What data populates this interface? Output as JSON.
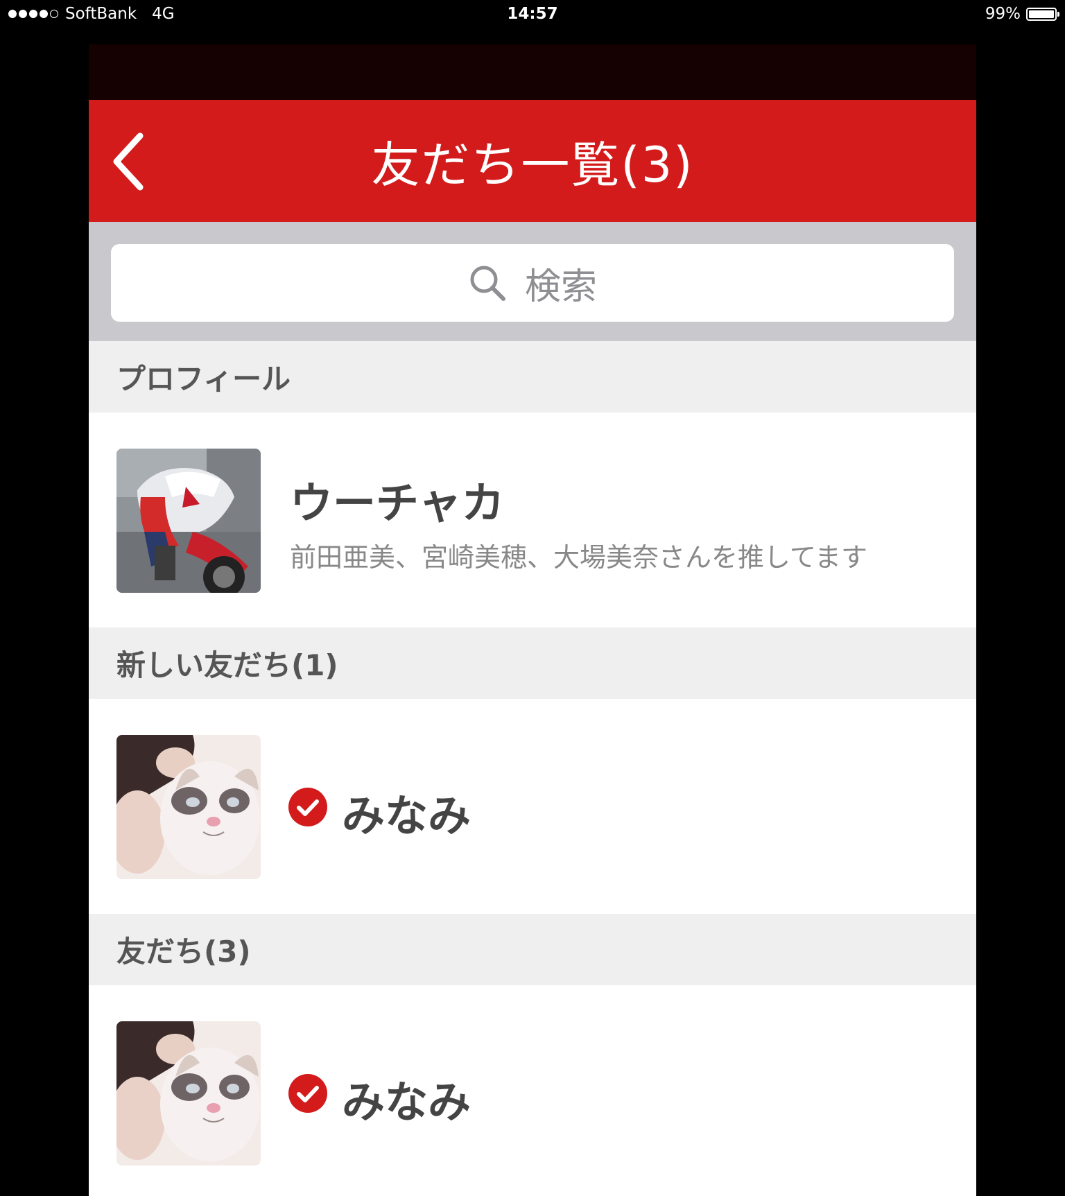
{
  "status_bar": {
    "carrier": "SoftBank",
    "network": "4G",
    "time": "14:57",
    "battery": "99%",
    "battery_level": 0.99
  },
  "nav": {
    "title": "友だち一覧(3)",
    "back_icon": "chevron-left-icon",
    "color": "#d31b1c"
  },
  "search": {
    "placeholder": "検索",
    "icon": "search-icon"
  },
  "sections": {
    "profile": {
      "header": "プロフィール",
      "name": "ウーチャカ",
      "status_message": "前田亜美、宮崎美穂、大場美奈さんを推してます"
    },
    "new_friends": {
      "header": "新しい友だち(1)",
      "items": [
        {
          "name": "みなみ",
          "icon": "check-circle-icon"
        }
      ]
    },
    "friends": {
      "header": "友だち(3)",
      "items": [
        {
          "name": "みなみ",
          "icon": "check-circle-icon"
        }
      ]
    }
  }
}
